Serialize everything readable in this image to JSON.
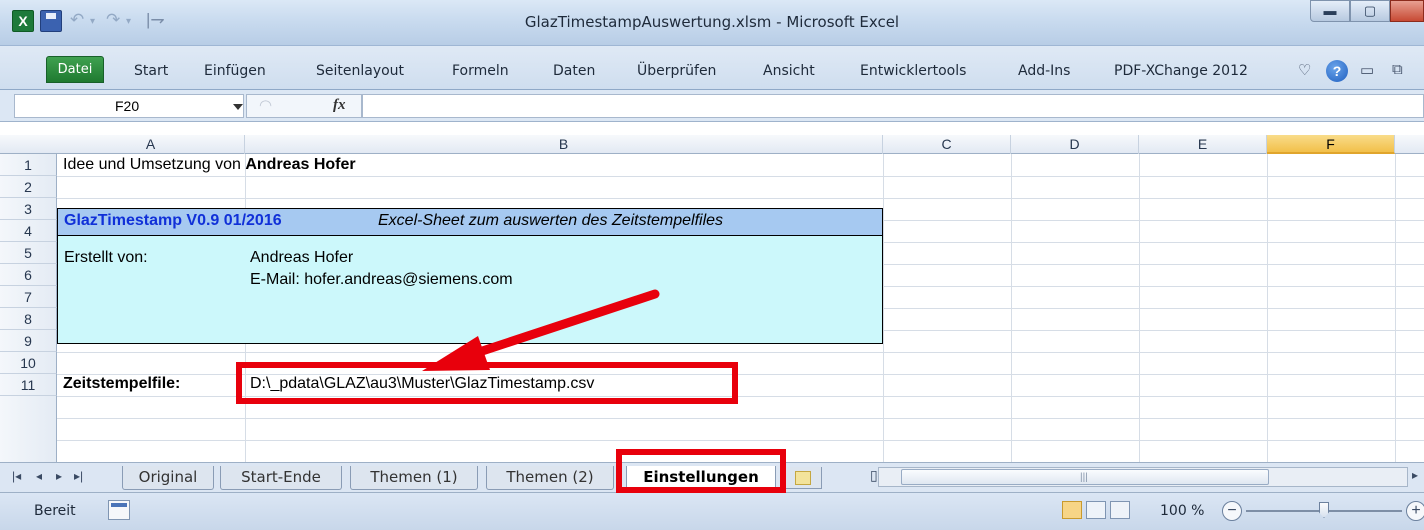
{
  "window": {
    "title": "GlazTimestampAuswertung.xlsm - Microsoft Excel",
    "app_icon_letter": "X"
  },
  "ribbon": {
    "file_tab": "Datei",
    "tabs": [
      "Start",
      "Einfügen",
      "Seitenlayout",
      "Formeln",
      "Daten",
      "Überprüfen",
      "Ansicht",
      "Entwicklertools",
      "Add-Ins",
      "PDF-XChange 2012"
    ],
    "help_icon": "?"
  },
  "formula_bar": {
    "name_box": "F20",
    "fx_label": "fx",
    "formula": ""
  },
  "columns": [
    "A",
    "B",
    "C",
    "D",
    "E",
    "F"
  ],
  "selected_column": "F",
  "rows": [
    "1",
    "2",
    "3",
    "4",
    "5",
    "6",
    "7",
    "8",
    "9",
    "10",
    "11"
  ],
  "cells": {
    "a1_prefix": "Idee und Umsetzung von ",
    "a1_name": "Andreas Hofer",
    "box_title": "GlazTimestamp V0.9  01/2016",
    "box_subtitle": "Excel-Sheet zum auswerten des Zeitstempelfiles",
    "created_by_label": "Erstellt von:",
    "created_by_name": "Andreas Hofer",
    "email": "E-Mail: hofer.andreas@siemens.com",
    "timestamp_label": "Zeitstempelfile:",
    "timestamp_path": "D:\\_pdata\\GLAZ\\au3\\Muster\\GlazTimestamp.csv"
  },
  "sheet_tabs": [
    "Original",
    "Start-Ende",
    "Themen (1)",
    "Themen (2)",
    "Einstellungen"
  ],
  "active_sheet": "Einstellungen",
  "status_bar": {
    "ready": "Bereit",
    "zoom": "100 %",
    "zoom_fraction": 0.5
  },
  "annotation_color": "#e8000c",
  "icons": [
    "excel-logo-icon",
    "save-icon",
    "undo-icon",
    "redo-icon",
    "help-icon",
    "fx-icon",
    "new-sheet-icon",
    "macro-record-icon",
    "zoom-out-icon",
    "zoom-in-icon"
  ]
}
